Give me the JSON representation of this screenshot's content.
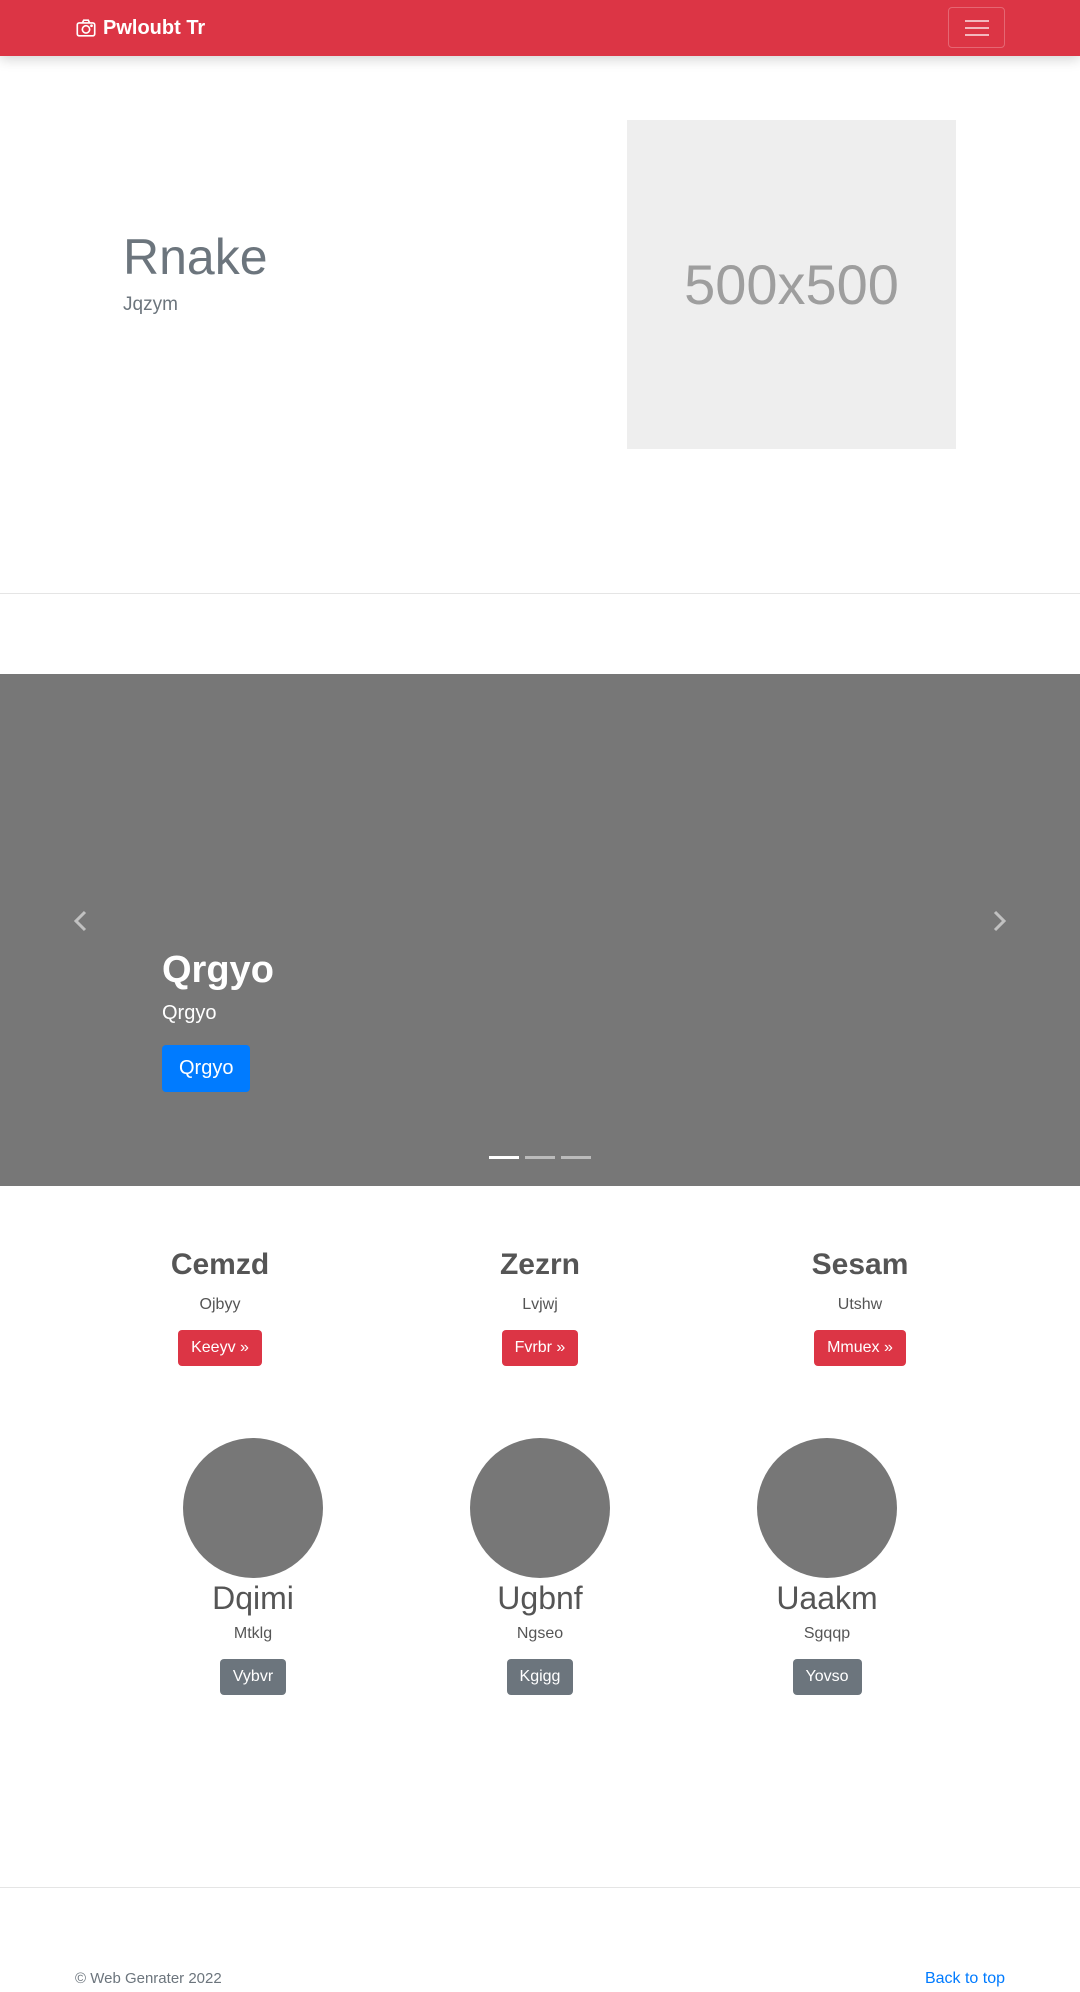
{
  "navbar": {
    "brand": "Pwloubt Tr",
    "brand_icon": "camera-icon",
    "toggler_icon": "hamburger-menu-icon",
    "bg_color": "#dc3545"
  },
  "hero": {
    "title": "Rnake",
    "subtitle": "Jqzym",
    "placeholder_text": "500x500"
  },
  "carousel": {
    "prev_icon": "chevron-left-icon",
    "next_icon": "chevron-right-icon",
    "caption_title": "Qrgyo",
    "caption_text": "Qrgyo",
    "button_label": "Qrgyo",
    "slide_count": 3,
    "active_slide": 1
  },
  "features": [
    {
      "title": "Cemzd",
      "text": "Ojbyy",
      "button": "Keeyv »"
    },
    {
      "title": "Zezrn",
      "text": "Lvjwj",
      "button": "Fvrbr »"
    },
    {
      "title": "Sesam",
      "text": "Utshw",
      "button": "Mmuex »"
    }
  ],
  "people": [
    {
      "name": "Dqimi",
      "text": "Mtklg",
      "button": "Vybvr"
    },
    {
      "name": "Ugbnf",
      "text": "Ngseo",
      "button": "Kgigg"
    },
    {
      "name": "Uaakm",
      "text": "Sgqqp",
      "button": "Yovso"
    }
  ],
  "footer": {
    "copyright": "© Web Genrater 2022",
    "back_to_top": "Back to top"
  },
  "colors": {
    "primary": "#007bff",
    "danger": "#dc3545",
    "secondary": "#6c757d",
    "carousel_bg": "#777777"
  }
}
